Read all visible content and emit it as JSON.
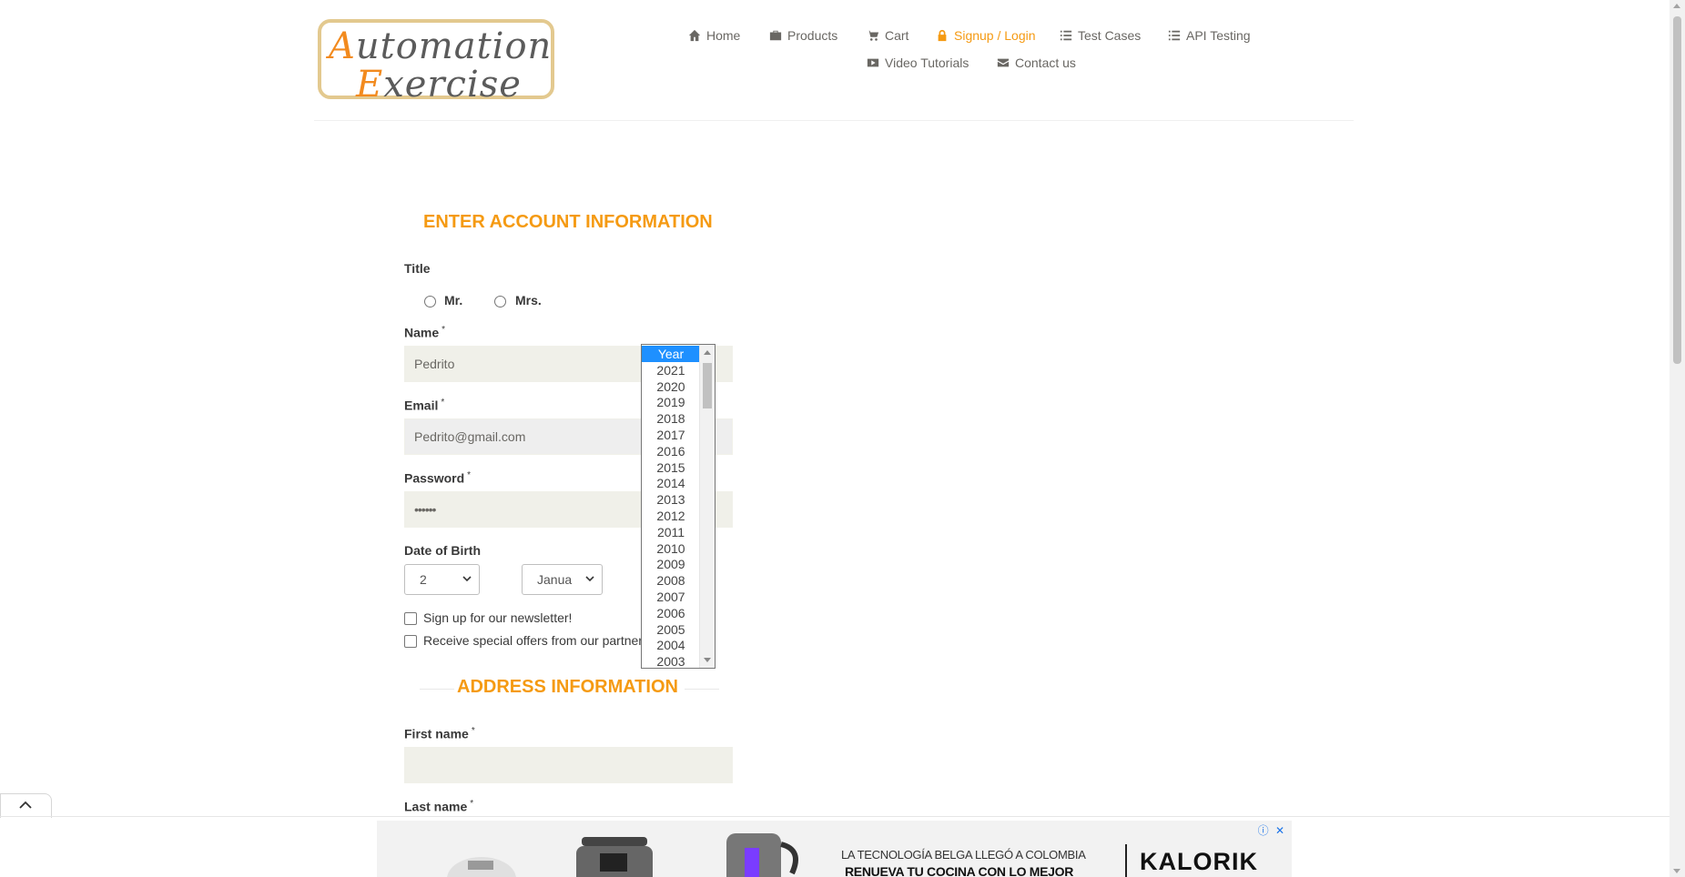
{
  "logo": {
    "line1_cap": "A",
    "line1_rest": "utomation",
    "line2_cap": "E",
    "line2_rest": "xercise"
  },
  "nav": {
    "items": [
      {
        "label": "Home",
        "icon": "home-icon"
      },
      {
        "label": "Products",
        "icon": "products-icon"
      },
      {
        "label": "Cart",
        "icon": "cart-icon"
      },
      {
        "label": "Signup / Login",
        "icon": "lock-icon",
        "active": true
      },
      {
        "label": "Test Cases",
        "icon": "list-icon"
      },
      {
        "label": "API Testing",
        "icon": "list-icon"
      },
      {
        "label": "Video Tutorials",
        "icon": "youtube-icon"
      },
      {
        "label": "Contact us",
        "icon": "envelope-icon"
      }
    ],
    "active_color": "#f59a12"
  },
  "form": {
    "account_title": "ENTER ACCOUNT INFORMATION",
    "title_label": "Title",
    "title_options": [
      "Mr.",
      "Mrs."
    ],
    "name_label": "Name",
    "name_value": "Pedrito",
    "email_label": "Email",
    "email_value": "Pedrito@gmail.com",
    "password_label": "Password",
    "password_value": "••••••",
    "required_mark": "*",
    "dob_label": "Date of Birth",
    "dob_day": "2",
    "dob_month": "Janua",
    "newsletter_label": "Sign up for our newsletter!",
    "offers_label": "Receive special offers from our partner",
    "address_title": "ADDRESS INFORMATION",
    "first_name_label": "First name",
    "first_name_value": "",
    "last_name_label": "Last name"
  },
  "year_dropdown": {
    "selected": "Year",
    "options": [
      "Year",
      "2021",
      "2020",
      "2019",
      "2018",
      "2017",
      "2016",
      "2015",
      "2014",
      "2013",
      "2012",
      "2011",
      "2010",
      "2009",
      "2008",
      "2007",
      "2006",
      "2005",
      "2004",
      "2003"
    ]
  },
  "ad": {
    "line1": "LA TECNOLOGÍA BELGA LLEGÓ A COLOMBIA",
    "line2": "RENUEVA TU COCINA CON LO MEJOR",
    "brand": "KALORIK"
  }
}
